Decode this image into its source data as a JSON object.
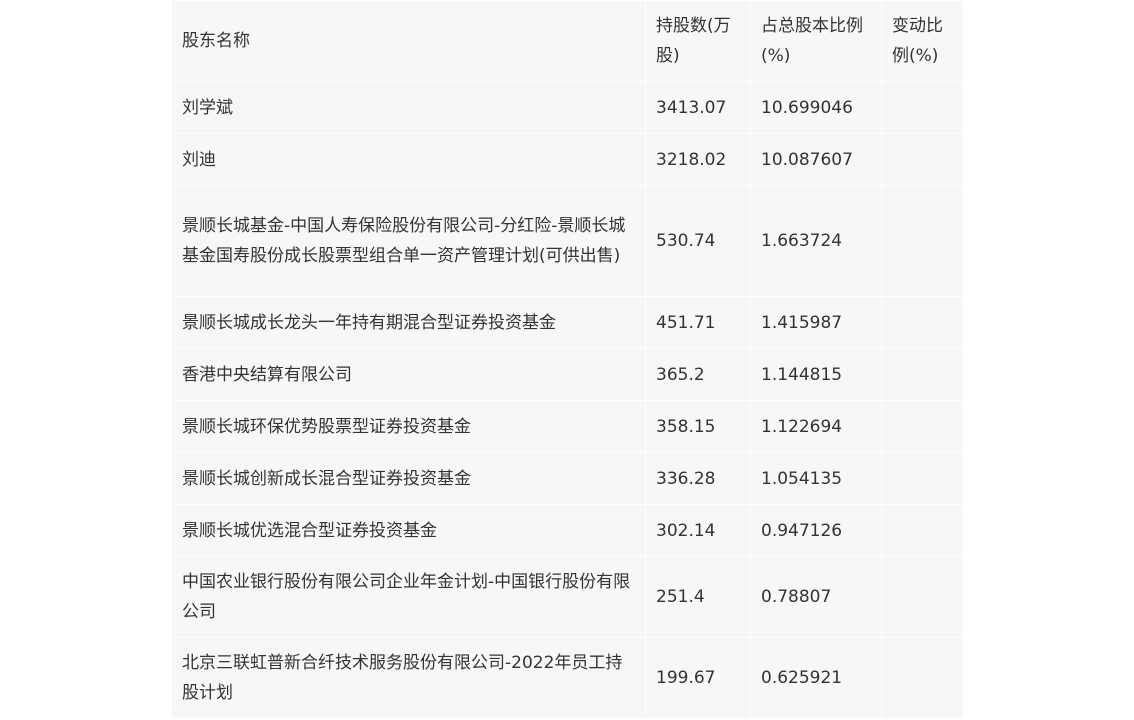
{
  "table": {
    "headers": [
      "股东名称",
      "持股数(万股)",
      "占总股本比例(%)",
      "变动比例(%)"
    ],
    "rows": [
      {
        "name": "刘学斌",
        "shares": "3413.07",
        "ratio": "10.699046",
        "change": ""
      },
      {
        "name": "刘迪",
        "shares": "3218.02",
        "ratio": "10.087607",
        "change": ""
      },
      {
        "name": "景顺长城基金-中国人寿保险股份有限公司-分红险-景顺长城基金国寿股份成长股票型组合单一资产管理计划(可供出售)",
        "shares": "530.74",
        "ratio": "1.663724",
        "change": ""
      },
      {
        "name": "景顺长城成长龙头一年持有期混合型证券投资基金",
        "shares": "451.71",
        "ratio": "1.415987",
        "change": ""
      },
      {
        "name": "香港中央结算有限公司",
        "shares": "365.2",
        "ratio": "1.144815",
        "change": ""
      },
      {
        "name": "景顺长城环保优势股票型证券投资基金",
        "shares": "358.15",
        "ratio": "1.122694",
        "change": ""
      },
      {
        "name": "景顺长城创新成长混合型证券投资基金",
        "shares": "336.28",
        "ratio": "1.054135",
        "change": ""
      },
      {
        "name": "景顺长城优选混合型证券投资基金",
        "shares": "302.14",
        "ratio": "0.947126",
        "change": ""
      },
      {
        "name": "中国农业银行股份有限公司企业年金计划-中国银行股份有限公司",
        "shares": "251.4",
        "ratio": "0.78807",
        "change": ""
      },
      {
        "name": "北京三联虹普新合纤技术服务股份有限公司-2022年员工持股计划",
        "shares": "199.67",
        "ratio": "0.625921",
        "change": ""
      }
    ]
  }
}
